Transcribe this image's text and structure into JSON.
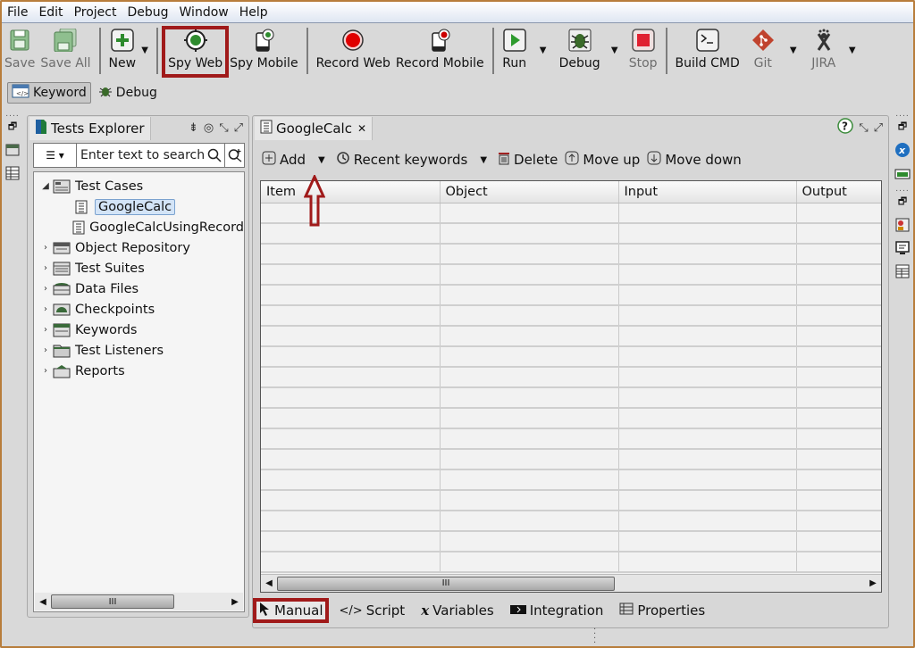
{
  "menu": [
    "File",
    "Edit",
    "Project",
    "Debug",
    "Window",
    "Help"
  ],
  "toolbar": {
    "save": "Save",
    "save_all": "Save All",
    "new": "New",
    "spy_web": "Spy Web",
    "spy_mobile": "Spy Mobile",
    "record_web": "Record Web",
    "record_mobile": "Record Mobile",
    "run": "Run",
    "debug": "Debug",
    "stop": "Stop",
    "build_cmd": "Build CMD",
    "git": "Git",
    "jira": "JIRA"
  },
  "perspectives": {
    "keyword": "Keyword",
    "debug": "Debug"
  },
  "explorer": {
    "title": "Tests Explorer",
    "search_placeholder": "Enter text to search...",
    "tree": [
      {
        "label": "Test Cases",
        "expanded": true,
        "icon": "test-cases-icon"
      },
      {
        "label": "GoogleCalc",
        "child": true,
        "selected": true,
        "icon": "test-case-icon"
      },
      {
        "label": "GoogleCalcUsingRecord",
        "child": true,
        "icon": "test-case-icon"
      },
      {
        "label": "Object Repository",
        "icon": "object-repository-icon"
      },
      {
        "label": "Test Suites",
        "icon": "test-suites-icon"
      },
      {
        "label": "Data Files",
        "icon": "data-files-icon"
      },
      {
        "label": "Checkpoints",
        "icon": "checkpoints-icon"
      },
      {
        "label": "Keywords",
        "icon": "keywords-icon"
      },
      {
        "label": "Test Listeners",
        "icon": "test-listeners-icon"
      },
      {
        "label": "Reports",
        "icon": "reports-icon"
      }
    ]
  },
  "editor": {
    "tab_title": "GoogleCalc",
    "actions": {
      "add": "Add",
      "recent_keywords": "Recent keywords",
      "delete": "Delete",
      "move_up": "Move up",
      "move_down": "Move down"
    },
    "columns": [
      "Item",
      "Object",
      "Input",
      "Output"
    ],
    "row_count": 18,
    "bottom_tabs": [
      "Manual",
      "Script",
      "Variables",
      "Integration",
      "Properties"
    ],
    "active_bottom_tab": "Manual"
  },
  "colors": {
    "highlight": "#a01a1a",
    "accent_green": "#3a8a3a",
    "record_red": "#e00000"
  }
}
